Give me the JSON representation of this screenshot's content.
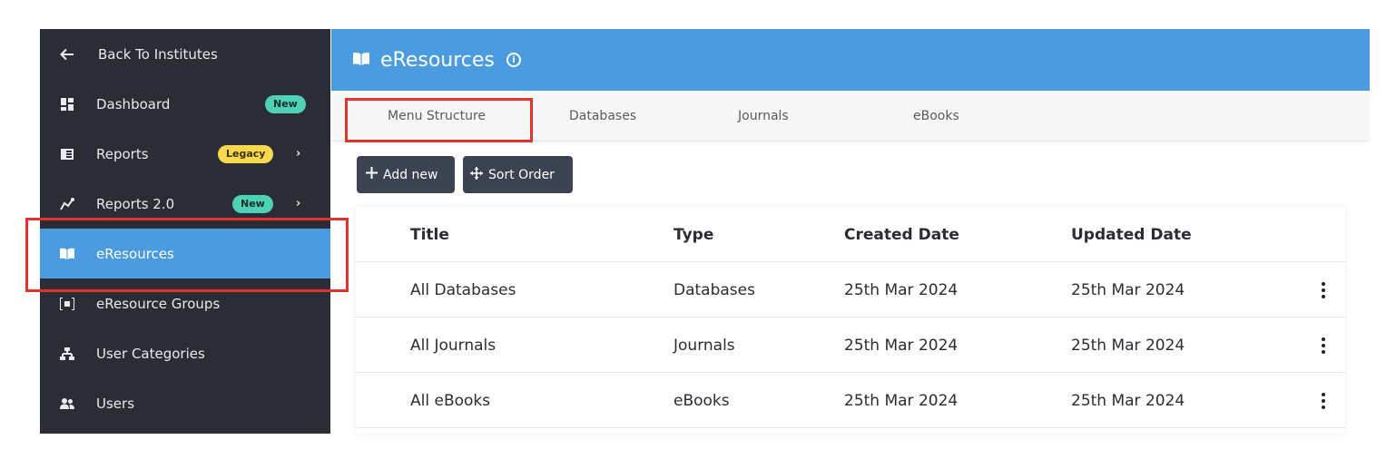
{
  "sidebar": {
    "back_label": "Back To Institutes",
    "items": [
      {
        "label": "Dashboard",
        "icon": "dashboard-icon",
        "badge": "New"
      },
      {
        "label": "Reports",
        "icon": "reports-icon",
        "badge": "Legacy"
      },
      {
        "label": "Reports 2.0",
        "icon": "reports-2-icon",
        "badge": "New"
      },
      {
        "label": "eResources",
        "icon": "book-icon",
        "active": true
      },
      {
        "label": "eResource Groups",
        "icon": "groups-icon"
      },
      {
        "label": "User Categories",
        "icon": "sitemap-icon"
      },
      {
        "label": "Users",
        "icon": "users-icon"
      }
    ]
  },
  "header": {
    "title": "eResources",
    "info_icon": "info-icon"
  },
  "tabs": [
    "Menu Structure",
    "Databases",
    "Journals",
    "eBooks"
  ],
  "toolbar": {
    "add_label": "Add new",
    "sort_label": "Sort Order"
  },
  "table": {
    "columns": [
      "Title",
      "Type",
      "Created Date",
      "Updated Date"
    ],
    "rows": [
      [
        "All Databases",
        "Databases",
        "25th Mar 2024",
        "25th Mar 2024"
      ],
      [
        "All Journals",
        "Journals",
        "25th Mar 2024",
        "25th Mar 2024"
      ],
      [
        "All eBooks",
        "eBooks",
        "25th Mar 2024",
        "25th Mar 2024"
      ]
    ]
  },
  "colors": {
    "sidebar_bg": "#2a2c36",
    "accent": "#4a9be0",
    "highlight": "#e2342d",
    "badge_new": "#4fd1b6",
    "badge_legacy": "#f8d84c"
  }
}
